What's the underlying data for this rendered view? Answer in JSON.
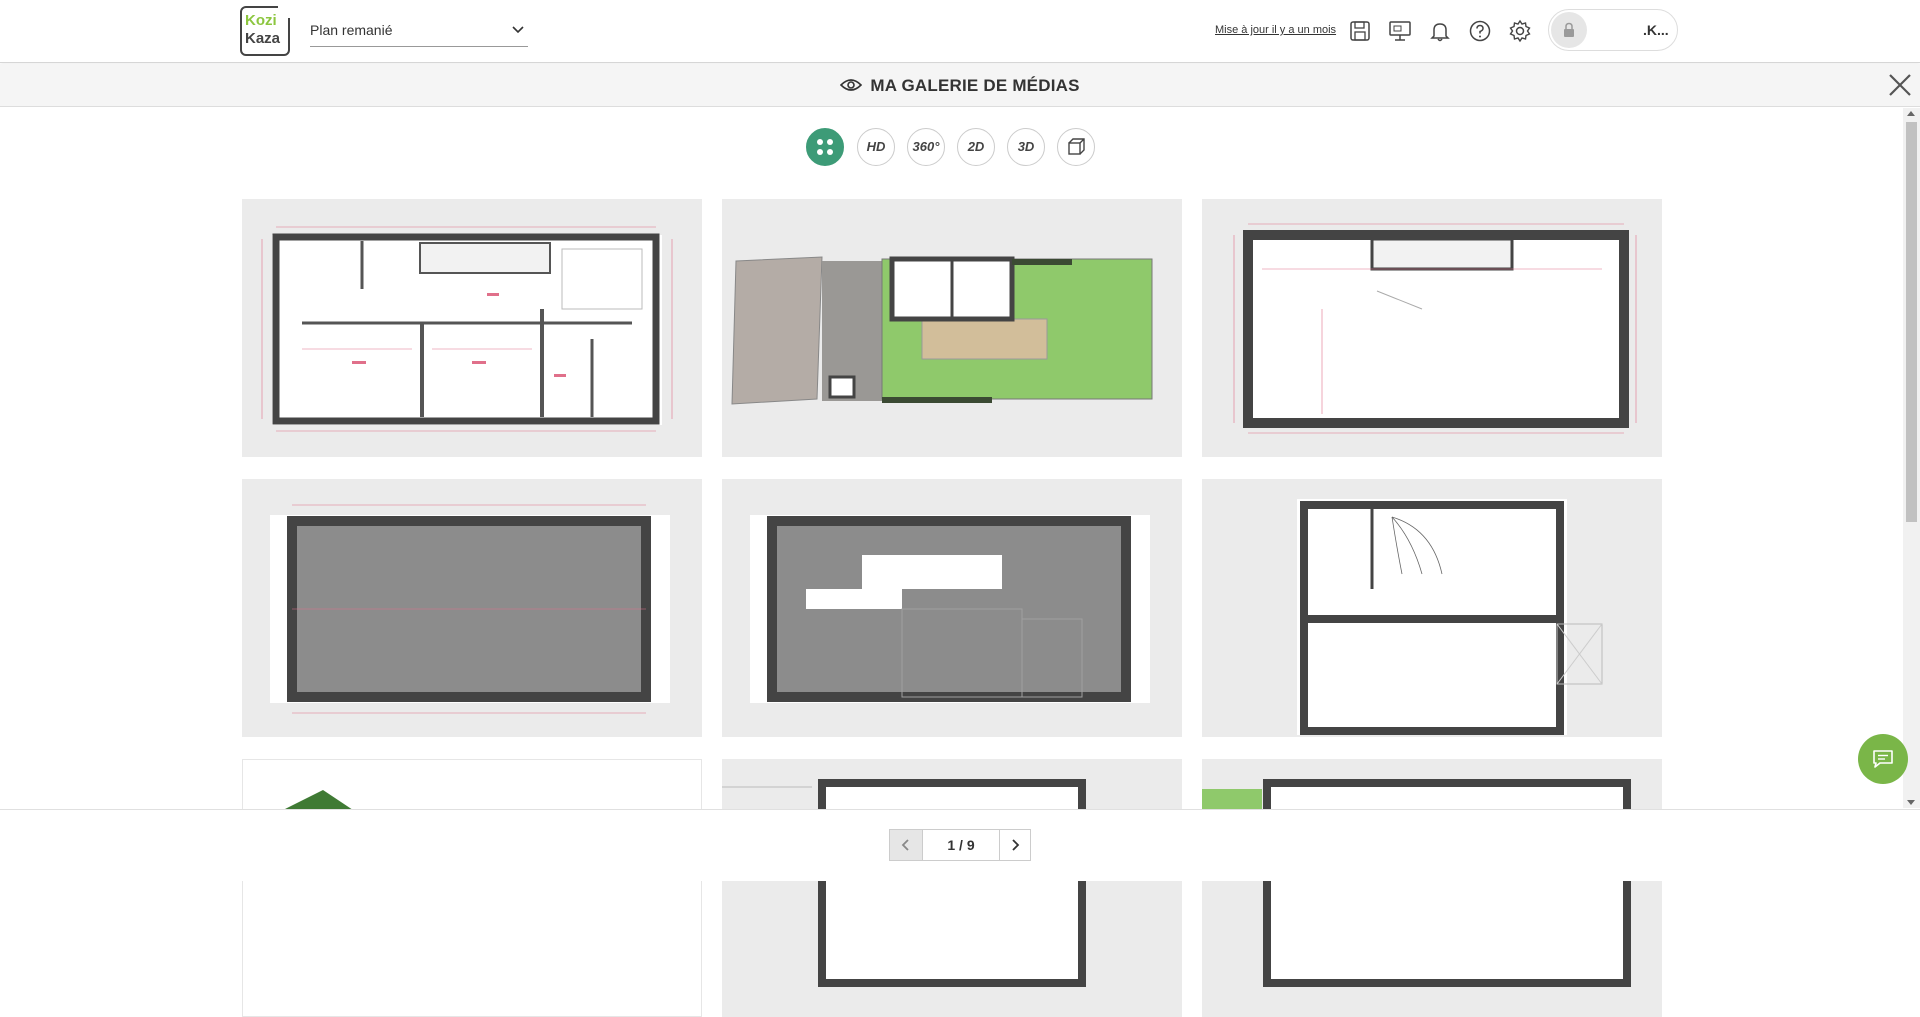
{
  "header": {
    "logo_line1": "Kozi",
    "logo_line2": "Kaza",
    "plan_selected": "Plan remanié",
    "updated_label": "Mise à jour il y a un mois",
    "icons": [
      "save-icon",
      "presentation-icon",
      "bell-icon",
      "help-icon",
      "settings-icon"
    ],
    "user_name": ".K..."
  },
  "gallery": {
    "title": "MA GALERIE DE MÉDIAS",
    "filters": [
      {
        "label": "",
        "icon": "all-grid-icon",
        "active": true
      },
      {
        "label": "HD",
        "active": false
      },
      {
        "label": "360°",
        "active": false
      },
      {
        "label": "2D",
        "active": false
      },
      {
        "label": "3D",
        "active": false
      },
      {
        "label": "",
        "icon": "cube-icon",
        "active": false
      }
    ]
  },
  "pagination": {
    "current": "1 / 9"
  },
  "colors": {
    "accent": "#3d9b77",
    "chat": "#7ab648",
    "wall": "#444444",
    "garden": "#8fc96b"
  }
}
